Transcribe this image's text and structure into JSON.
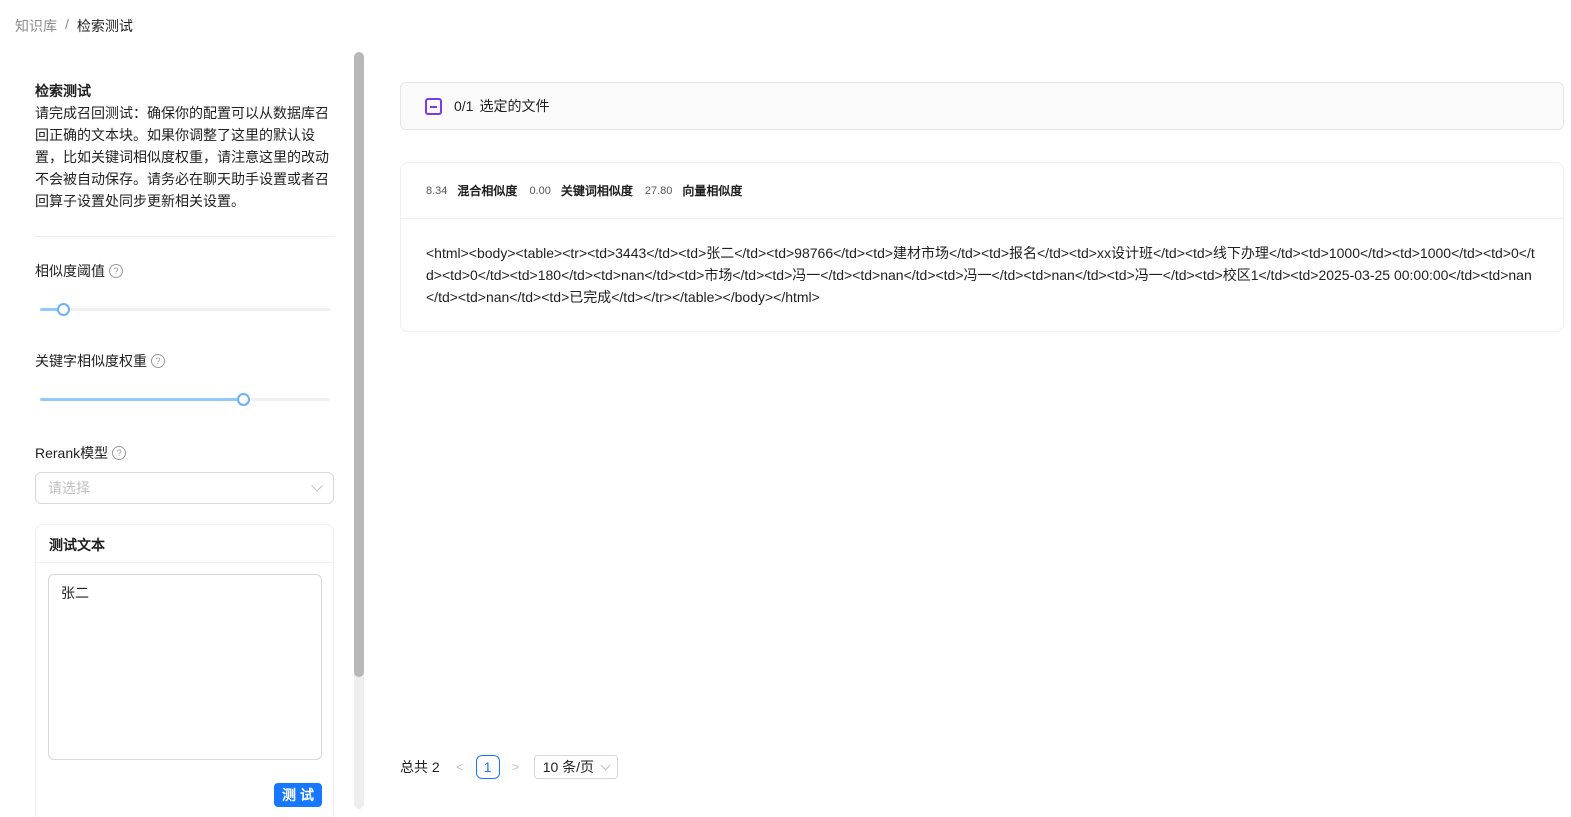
{
  "breadcrumb": {
    "root": "知识库",
    "separator": "/",
    "current": "检索测试"
  },
  "intro": {
    "title": "检索测试",
    "description": "请完成召回测试：确保你的配置可以从数据库召回正确的文本块。如果你调整了这里的默认设置，比如关键词相似度权重，请注意这里的改动不会被自动保存。请务必在聊天助手设置或者召回算子设置处同步更新相关设置。"
  },
  "similarity_threshold": {
    "label": "相似度阈值",
    "value": 0.08
  },
  "keyword_weight": {
    "label": "关键字相似度权重",
    "value": 0.7
  },
  "rerank": {
    "label": "Rerank模型",
    "placeholder": "请选择"
  },
  "test_card": {
    "title": "测试文本",
    "text": "张二",
    "button": "测试"
  },
  "file_selector": {
    "count": "0/1",
    "label": "选定的文件"
  },
  "result": {
    "hybrid_score": "8.34",
    "hybrid_label": "混合相似度",
    "keyword_score": "0.00",
    "keyword_label": "关键词相似度",
    "vector_score": "27.80",
    "vector_label": "向量相似度",
    "content": "<html><body><table><tr><td>3443</td><td>张二</td><td>98766</td><td>建材市场</td><td>报名</td><td>xx设计班</td><td>线下办理</td><td>1000</td><td>1000</td><td>0</td><td>0</td><td>180</td><td>nan</td><td>市场</td><td>冯一</td><td>nan</td><td>冯一</td><td>nan</td><td>冯一</td><td>校区1</td><td>2025-03-25 00:00:00</td><td>nan</td><td>nan</td><td>已完成</td></tr></table></body></html>"
  },
  "pagination": {
    "total": "总共 2",
    "prev": "<",
    "page": "1",
    "next": ">",
    "page_size": "10 条/页"
  },
  "colors": {
    "accent": "#1677ff",
    "checkbox": "#7c3aed",
    "slider_track": "#91caff"
  }
}
